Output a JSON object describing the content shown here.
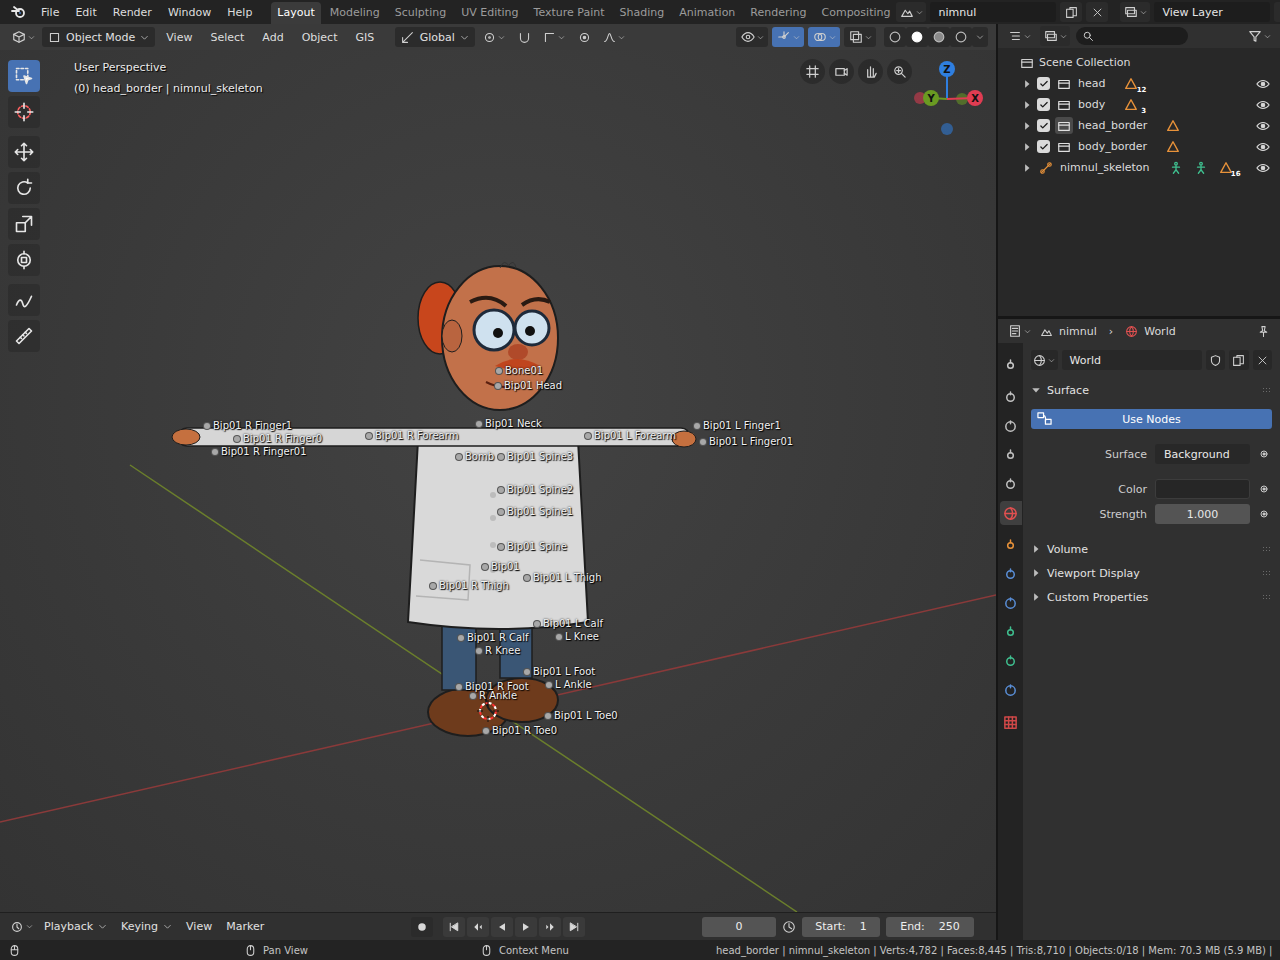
{
  "top_bar": {
    "menus": [
      "File",
      "Edit",
      "Render",
      "Window",
      "Help"
    ],
    "workspaces": [
      {
        "label": "Layout",
        "selected": true
      },
      {
        "label": "Modeling",
        "selected": false
      },
      {
        "label": "Sculpting",
        "selected": false
      },
      {
        "label": "UV Editing",
        "selected": false
      },
      {
        "label": "Texture Paint",
        "selected": false
      },
      {
        "label": "Shading",
        "selected": false
      },
      {
        "label": "Animation",
        "selected": false
      },
      {
        "label": "Rendering",
        "selected": false
      },
      {
        "label": "Compositing",
        "selected": false
      }
    ],
    "scene": "nimnul",
    "view_layer": "View Layer"
  },
  "viewport": {
    "header": {
      "mode": "Object Mode",
      "menus": [
        "View",
        "Select",
        "Add",
        "Object",
        "GIS"
      ],
      "orientation": "Global",
      "toggles": [
        {
          "selected": false
        },
        {
          "selected": true
        },
        {
          "selected": true
        },
        {
          "selected": false
        }
      ],
      "shading": [
        {
          "selected": false
        },
        {
          "selected": true
        },
        {
          "selected": false
        },
        {
          "selected": false
        }
      ]
    },
    "info": [
      "User Perspective",
      "(0) head_border | nimnul_skeleton"
    ],
    "tools": [
      [
        {
          "selected": true
        },
        {
          "selected": false
        }
      ],
      [
        {
          "selected": false
        },
        {
          "selected": false
        },
        {
          "selected": false
        },
        {
          "selected": false
        }
      ],
      [
        {
          "selected": false
        },
        {
          "selected": false
        }
      ]
    ],
    "gizmo": [
      {
        "label": "Z",
        "color": "#2f7fe0"
      },
      {
        "label": "Y",
        "color": "#6a9a22"
      },
      {
        "label": "X",
        "color": "#e03c52"
      }
    ],
    "bones": [
      "Bone01",
      "Bip01 Head",
      "Bip01 R Finger1",
      "Bip01 R Finger0",
      "Bip01 R Finger01",
      "Bip01 R Forearm",
      "Bip01 Neck",
      "Bip01 L Forearm",
      "Bip01 L Finger1",
      "Bip01 L Finger01",
      "Bomb",
      "Bip01 Spine3",
      "Bip01 Spine2",
      "Bip01 Spine1",
      "Bip01 Spine",
      "Bip01",
      "Bip01 L Thigh",
      "Bip01 R Thigh",
      "Bip01 L Calf",
      "L Knee",
      "Bip01 R Calf",
      "R Knee",
      "Bip01 L Foot",
      "L Ankle",
      "Bip01 R Foot",
      "R Ankle",
      "Bip01 L Toe0",
      "Bip01 R Toe0"
    ]
  },
  "outliner": {
    "root": "Scene Collection",
    "items": [
      {
        "name": "head",
        "kind": "collection",
        "expanded": false,
        "checked": true,
        "active": false,
        "visible": true,
        "contents": [
          {
            "kind": "mesh",
            "count": "12"
          }
        ]
      },
      {
        "name": "body",
        "kind": "collection",
        "expanded": false,
        "checked": true,
        "active": false,
        "visible": true,
        "contents": [
          {
            "kind": "mesh",
            "count": "3"
          }
        ]
      },
      {
        "name": "head_border",
        "kind": "collection",
        "expanded": false,
        "checked": true,
        "active": true,
        "visible": true,
        "contents": [
          {
            "kind": "mesh"
          }
        ]
      },
      {
        "name": "body_border",
        "kind": "collection",
        "expanded": false,
        "checked": true,
        "active": false,
        "visible": true,
        "contents": [
          {
            "kind": "mesh"
          }
        ]
      },
      {
        "name": "nimnul_skeleton",
        "kind": "armature",
        "expanded": false,
        "active": false,
        "visible": true,
        "contents": [
          {
            "kind": "armature"
          },
          {
            "kind": "armature"
          },
          {
            "kind": "mesh",
            "count": "16"
          }
        ]
      }
    ]
  },
  "properties": {
    "breadcrumb": [
      "nimnul",
      "World"
    ],
    "separator": "›",
    "tabs": [
      [
        {
          "selected": false
        }
      ],
      [
        {
          "selected": false
        },
        {
          "selected": false
        },
        {
          "selected": false
        },
        {
          "selected": false
        },
        {
          "selected": true
        }
      ],
      [
        {
          "selected": false
        },
        {
          "selected": false
        },
        {
          "selected": false
        },
        {
          "selected": false
        },
        {
          "selected": false
        },
        {
          "selected": false
        }
      ],
      [
        {
          "selected": false
        }
      ]
    ],
    "datablock": "World",
    "use_nodes": "Use Nodes",
    "panels": [
      {
        "label": "Surface",
        "expanded": true
      },
      {
        "label": "Volume",
        "expanded": false
      },
      {
        "label": "Viewport Display",
        "expanded": false
      },
      {
        "label": "Custom Properties",
        "expanded": false
      }
    ],
    "fields": [
      {
        "label": "Surface",
        "kind": "dropdown",
        "value": "Background"
      },
      {
        "label": "Color",
        "kind": "color",
        "color": "#262626"
      },
      {
        "label": "Strength",
        "kind": "number",
        "value": "1.000"
      }
    ]
  },
  "timeline": {
    "menus": [
      {
        "label": "Playback",
        "dropdown": true
      },
      {
        "label": "Keying",
        "dropdown": true
      },
      {
        "label": "View",
        "dropdown": false
      },
      {
        "label": "Marker",
        "dropdown": false
      }
    ],
    "frame": "0",
    "start_label": "Start:",
    "start": "1",
    "end_label": "End:",
    "end": "250"
  },
  "status_bar": {
    "hints": [
      "Pan View",
      "Context Menu"
    ],
    "stats": "head_border | nimnul_skeleton | Verts:4,782 | Faces:8,445 | Tris:8,710 | Objects:0/18 | Mem: 70.3 MB (5.9 MB) |"
  }
}
